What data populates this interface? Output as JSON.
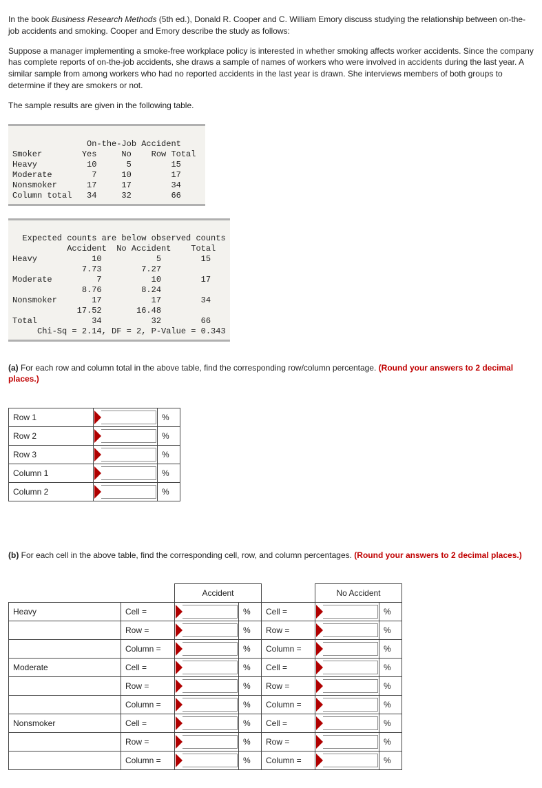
{
  "intro": {
    "p1_a": "In the book ",
    "p1_title": "Business Research Methods",
    "p1_b": " (5th ed.), Donald R. Cooper and C. William Emory discuss studying the relationship between on-the-job accidents and smoking. Cooper and Emory describe the study as follows:",
    "p2": "Suppose a manager implementing a smoke-free workplace policy is interested in whether smoking affects worker accidents. Since the company has complete reports of on-the-job accidents, she draws a sample of names of workers who were involved in accidents during the last year. A similar sample from among workers who had no reported accidents in the last year is drawn. She interviews members of both groups to determine if they are smokers or not.",
    "p3": "The sample results are given in the following table."
  },
  "block1": {
    "l1": "               On-the-Job Accident    ",
    "l2": "Smoker        Yes     No    Row Total",
    "l3": "Heavy          10      5        15",
    "l4": "Moderate        7     10        17",
    "l5": "Nonsmoker      17     17        34",
    "l6": "Column total   34     32        66"
  },
  "block2": {
    "l1": "  Expected counts are below observed counts",
    "l2": "           Accident  No Accident    Total",
    "l3": "Heavy           10           5        15",
    "l4": "              7.73        7.27",
    "l5": "Moderate         7          10        17",
    "l6": "              8.76        8.24",
    "l7": "Nonsmoker       17          17        34",
    "l8": "             17.52       16.48",
    "l9": "Total           34          32        66",
    "l10": "     Chi-Sq = 2.14, DF = 2, P-Value = 0.343"
  },
  "qa": {
    "tag": "(a)",
    "text": " For each row and column total in the above table, find the corresponding row/column percentage. ",
    "round": "(Round your answers to 2 decimal places.)"
  },
  "tableA": {
    "rows": [
      "Row 1",
      "Row 2",
      "Row 3",
      "Column 1",
      "Column 2"
    ],
    "pct": "%"
  },
  "qb": {
    "tag": "(b)",
    "text": " For each cell in the above table, find the corresponding cell, row, and column percentages. ",
    "round": "(Round your answers to 2 decimal places.)"
  },
  "tableB": {
    "h_acc": "Accident",
    "h_noacc": "No Accident",
    "groups": [
      "Heavy",
      "Moderate",
      "Nonsmoker"
    ],
    "metrics": [
      "Cell =",
      "Row =",
      "Column ="
    ],
    "pct": "%"
  }
}
